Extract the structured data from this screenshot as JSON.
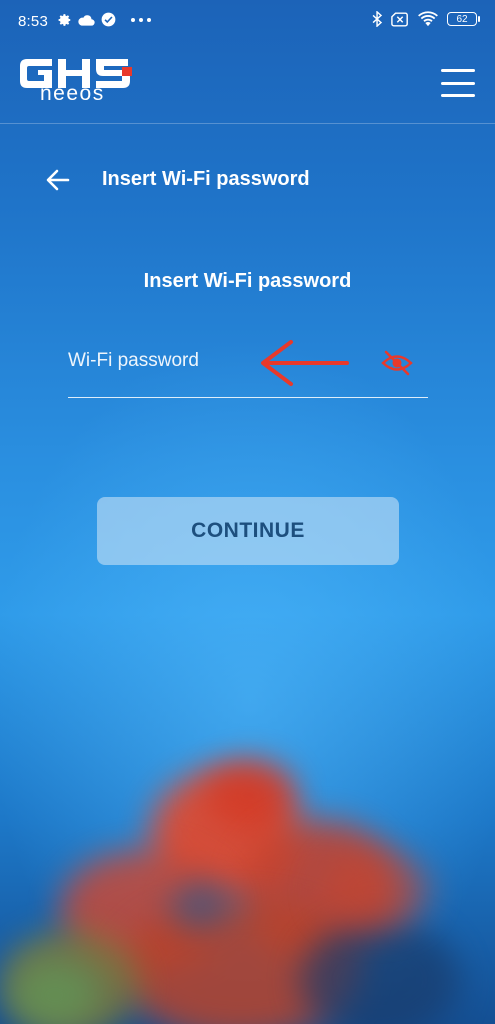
{
  "status_bar": {
    "time": "8:53",
    "battery": "62",
    "left_icons": [
      "gear-icon",
      "cloud-icon",
      "check-circle-icon",
      "more-dots-icon"
    ],
    "right_icons": [
      "bluetooth-icon",
      "no-sim-icon",
      "wifi-icon",
      "battery-icon"
    ]
  },
  "header": {
    "logo_text": "GHS",
    "logo_subtext": "neeos",
    "menu_icon": "hamburger-menu-icon"
  },
  "page": {
    "back_icon": "arrow-left-icon",
    "title": "Insert Wi-Fi password"
  },
  "form": {
    "section_title": "Insert Wi-Fi password",
    "password": {
      "placeholder": "Wi-Fi password",
      "value": "",
      "toggle_icon": "eye-off-icon",
      "toggle_color": "#e8392b"
    },
    "continue_label": "CONTINUE"
  },
  "annotation": {
    "icon": "red-arrow-left-icon",
    "color": "#e8392b"
  },
  "colors": {
    "background_top": "#1c63b8",
    "background_mid": "#2f9be9",
    "button_text": "#1d4f7e",
    "accent_red": "#e8392b"
  }
}
